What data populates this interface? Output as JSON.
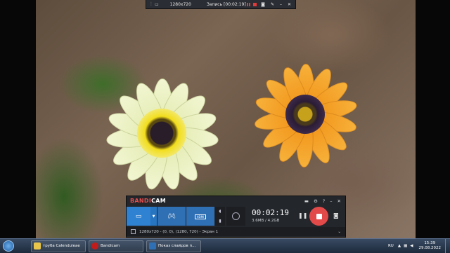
{
  "capture_bar": {
    "resolution": "1280x720",
    "recording_label": "Запись [00:02:19]",
    "icons": [
      "monitor-icon",
      "pause-icon",
      "stop-icon",
      "camera-icon",
      "pencil-icon",
      "minimize-icon",
      "close-icon"
    ]
  },
  "bandicam": {
    "logo_band": "BANDI",
    "logo_cam": "CAM",
    "timer": "00:02:19",
    "size": "3.6MB / 4.2GB",
    "region": "1280x720 - (0, 0), (1280, 720) - Экран 1",
    "hdmi": "HDMI"
  },
  "taskbar": {
    "items": [
      {
        "label": "труба Calenduleae"
      },
      {
        "label": "Bandicam"
      },
      {
        "label": "Показ слайдов п..."
      }
    ],
    "lang": "RU",
    "time": "15:39",
    "date": "29.08.2022"
  },
  "colors": {
    "accent": "#2f81d1",
    "record": "#e24a4a"
  }
}
